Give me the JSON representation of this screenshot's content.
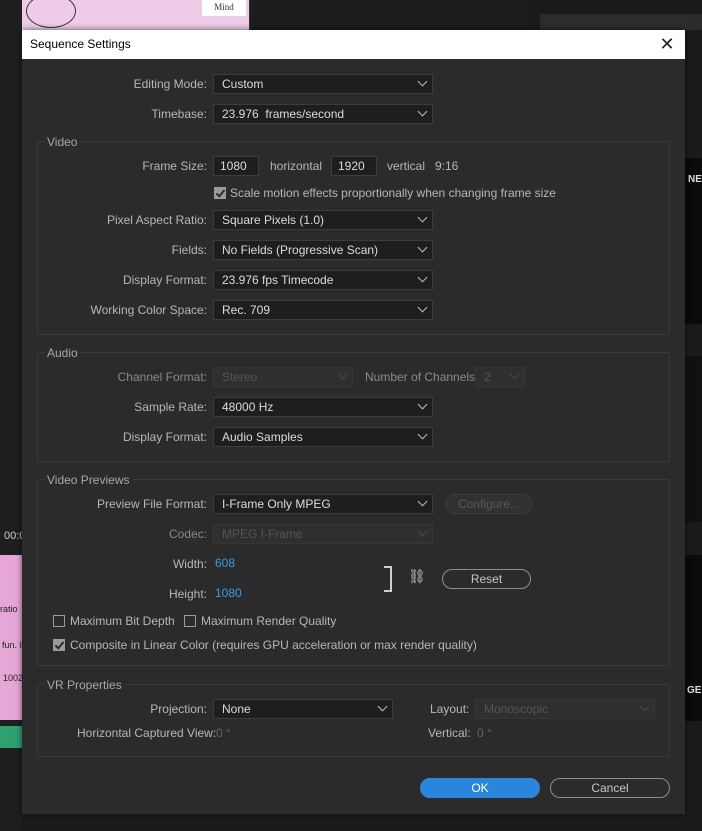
{
  "background": {
    "thumb_text": "Mind",
    "timeline_timecode": "00:0",
    "clip_labels": [
      "ratio",
      "fun. I",
      "1002"
    ],
    "right_thumb_texts": [
      "NE",
      "GE"
    ]
  },
  "dialog": {
    "title": "Sequence Settings",
    "editing_mode": {
      "label": "Editing Mode:",
      "value": "Custom"
    },
    "timebase": {
      "label": "Timebase:",
      "value": "23.976  frames/second"
    },
    "video": {
      "title": "Video",
      "frame_size_label": "Frame Size:",
      "width": "1080",
      "horizontal_label": "horizontal",
      "height": "1920",
      "vertical_label": "vertical",
      "ratio": "9:16",
      "scale_motion_label": "Scale motion effects proportionally when changing frame size",
      "scale_motion_checked": true,
      "pixel_aspect": {
        "label": "Pixel Aspect Ratio:",
        "value": "Square Pixels (1.0)"
      },
      "fields": {
        "label": "Fields:",
        "value": "No Fields (Progressive Scan)"
      },
      "display_format": {
        "label": "Display Format:",
        "value": "23.976 fps Timecode"
      },
      "working_color": {
        "label": "Working Color Space:",
        "value": "Rec. 709"
      }
    },
    "audio": {
      "title": "Audio",
      "channel_format": {
        "label": "Channel Format:",
        "value": "Stereo"
      },
      "num_channels": {
        "label": "Number of Channels:",
        "value": "2"
      },
      "sample_rate": {
        "label": "Sample Rate:",
        "value": "48000 Hz"
      },
      "display_format": {
        "label": "Display Format:",
        "value": "Audio Samples"
      }
    },
    "previews": {
      "title": "Video Previews",
      "file_format": {
        "label": "Preview File Format:",
        "value": "I-Frame Only MPEG"
      },
      "configure_label": "Configure...",
      "codec": {
        "label": "Codec:",
        "value": "MPEG I-Frame"
      },
      "width": {
        "label": "Width:",
        "value": "608"
      },
      "height": {
        "label": "Height:",
        "value": "1080"
      },
      "reset_label": "Reset",
      "max_bit_depth": {
        "label": "Maximum Bit Depth",
        "checked": false
      },
      "max_render_quality": {
        "label": "Maximum Render Quality",
        "checked": false
      },
      "composite_linear": {
        "label": "Composite in Linear Color (requires GPU acceleration or max render quality)",
        "checked": true
      }
    },
    "vr": {
      "title": "VR Properties",
      "projection": {
        "label": "Projection:",
        "value": "None"
      },
      "layout": {
        "label": "Layout:",
        "value": "Monoscopic"
      },
      "h_captured": {
        "label": "Horizontal Captured View:",
        "value": "0 °"
      },
      "vertical": {
        "label": "Vertical:",
        "value": "0 °"
      }
    },
    "ok_label": "OK",
    "cancel_label": "Cancel"
  }
}
